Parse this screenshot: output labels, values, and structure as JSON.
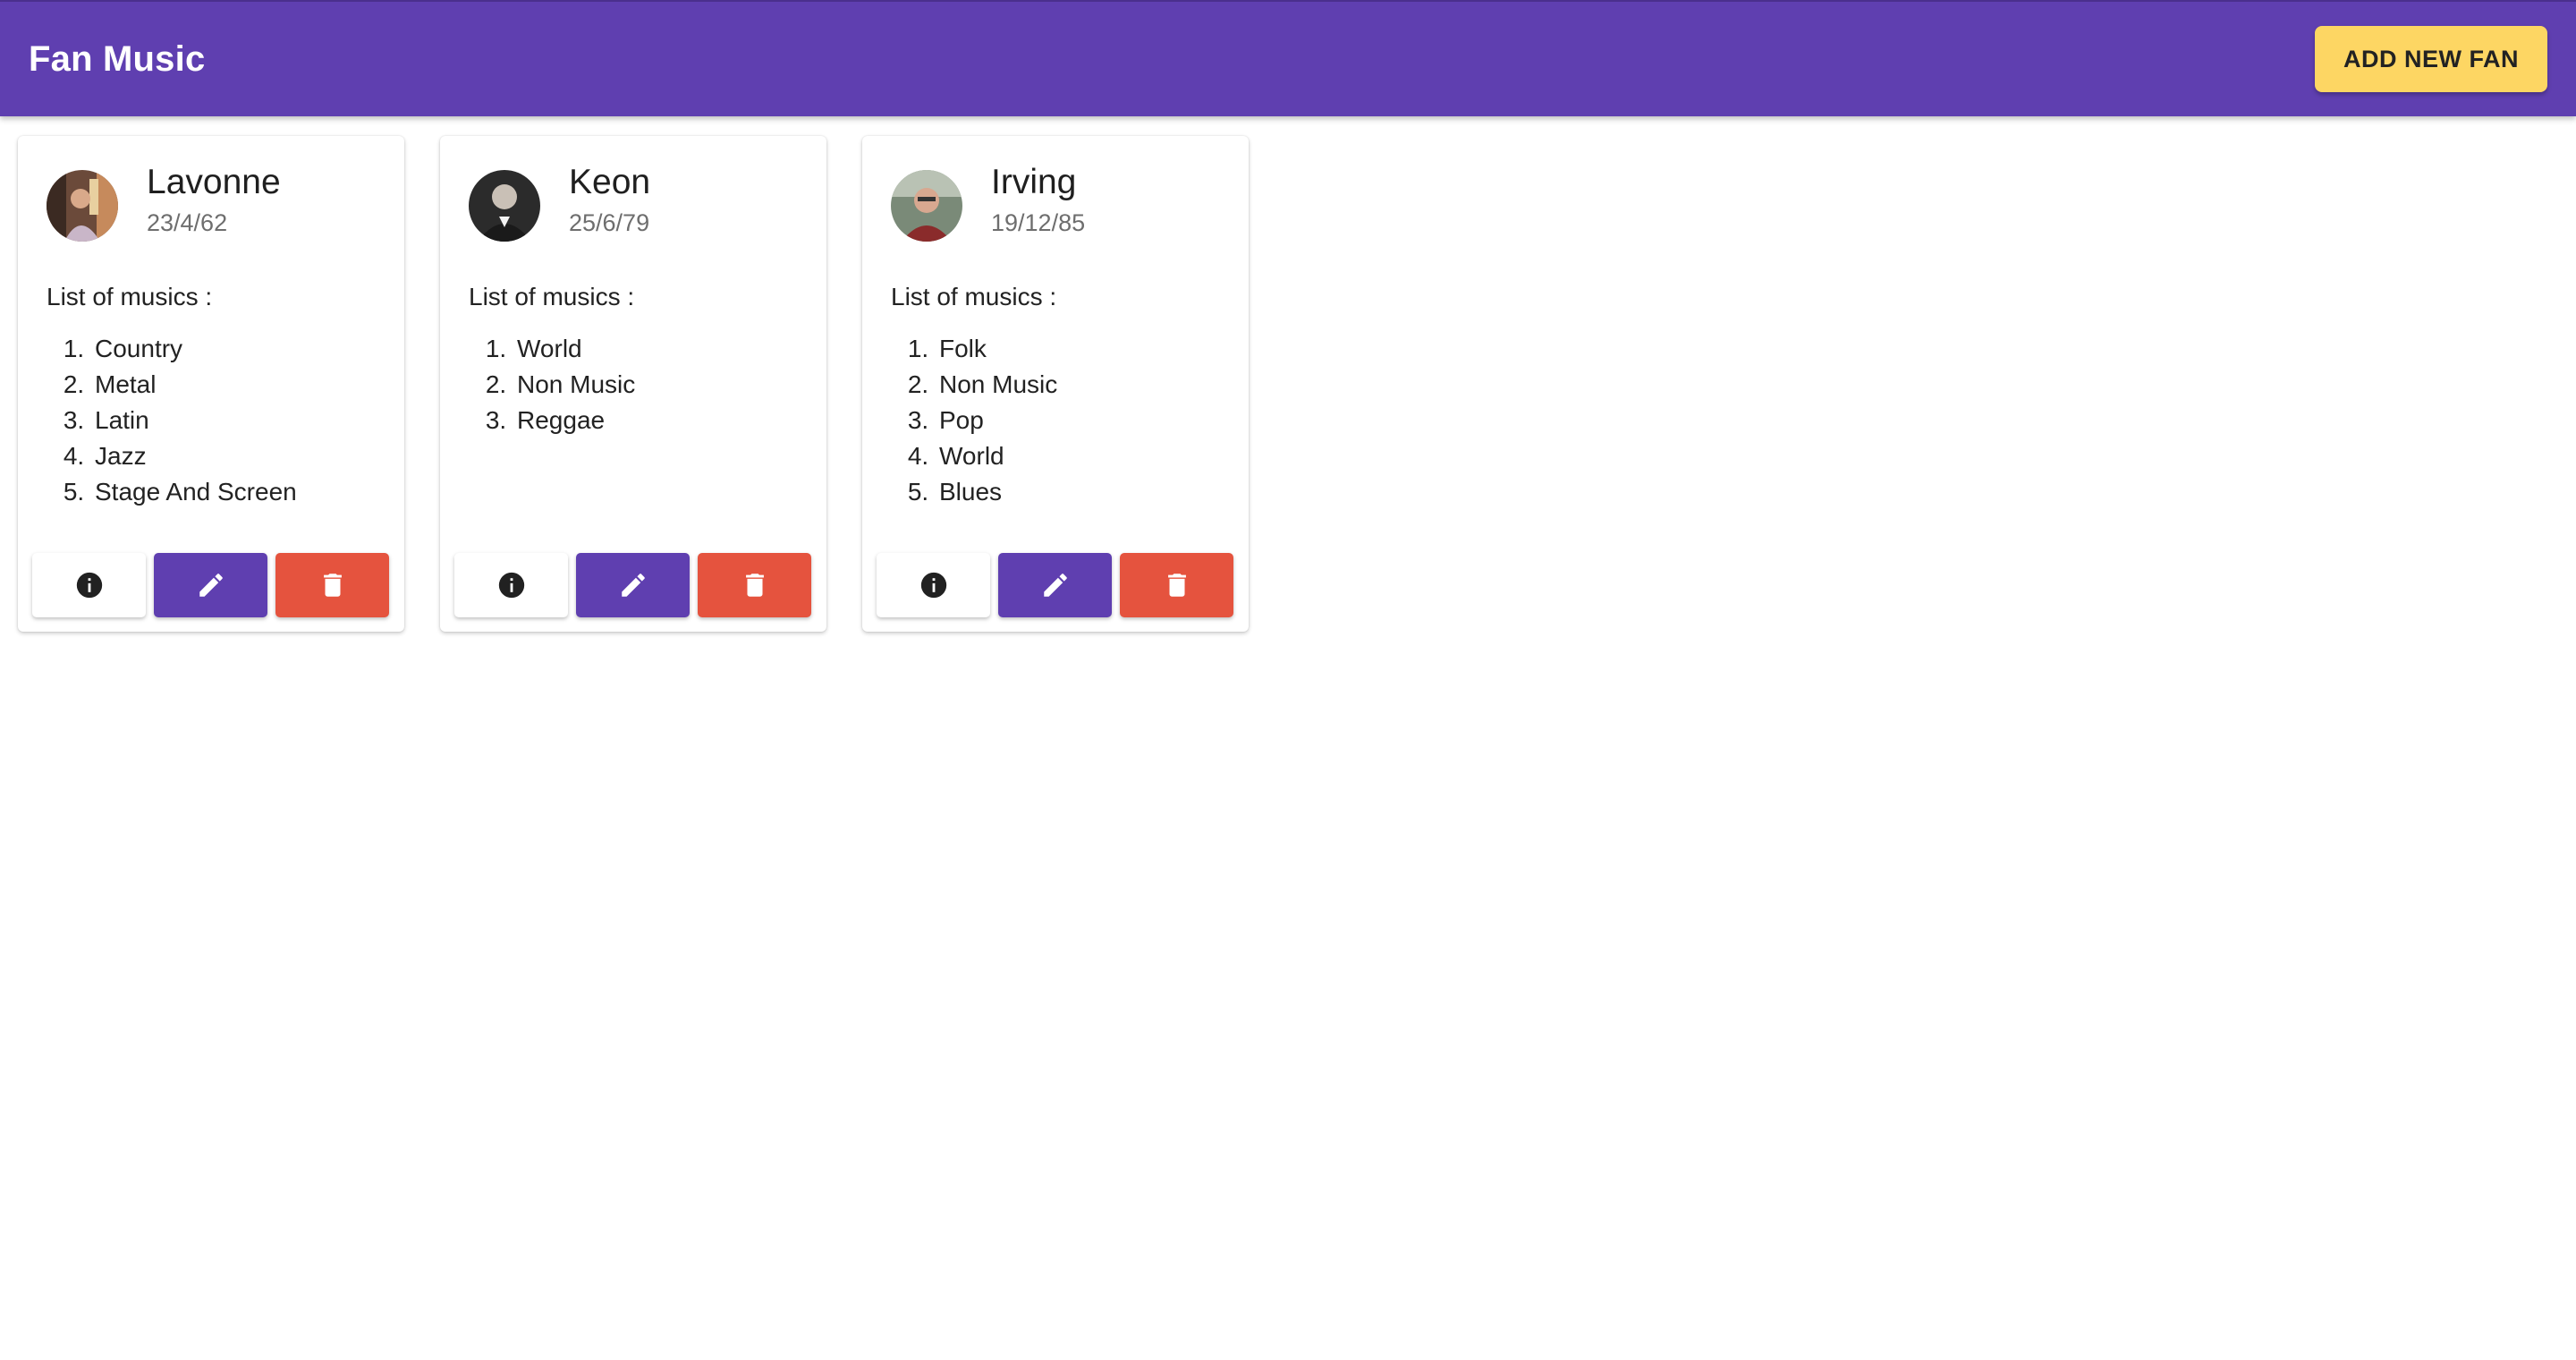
{
  "app": {
    "title": "Fan Music",
    "add_button_label": "ADD NEW FAN"
  },
  "colors": {
    "primary": "#5f3fb0",
    "accent": "#fdd663",
    "danger": "#e5533e"
  },
  "common": {
    "list_title": "List of musics :"
  },
  "fans": [
    {
      "name": "Lavonne",
      "date": "23/4/62",
      "musics": [
        "Country",
        "Metal",
        "Latin",
        "Jazz",
        "Stage And Screen"
      ]
    },
    {
      "name": "Keon",
      "date": "25/6/79",
      "musics": [
        "World",
        "Non Music",
        "Reggae"
      ]
    },
    {
      "name": "Irving",
      "date": "19/12/85",
      "musics": [
        "Folk",
        "Non Music",
        "Pop",
        "World",
        "Blues"
      ]
    }
  ],
  "icons": {
    "info": "info-icon",
    "edit": "pencil-icon",
    "delete": "trash-icon"
  }
}
